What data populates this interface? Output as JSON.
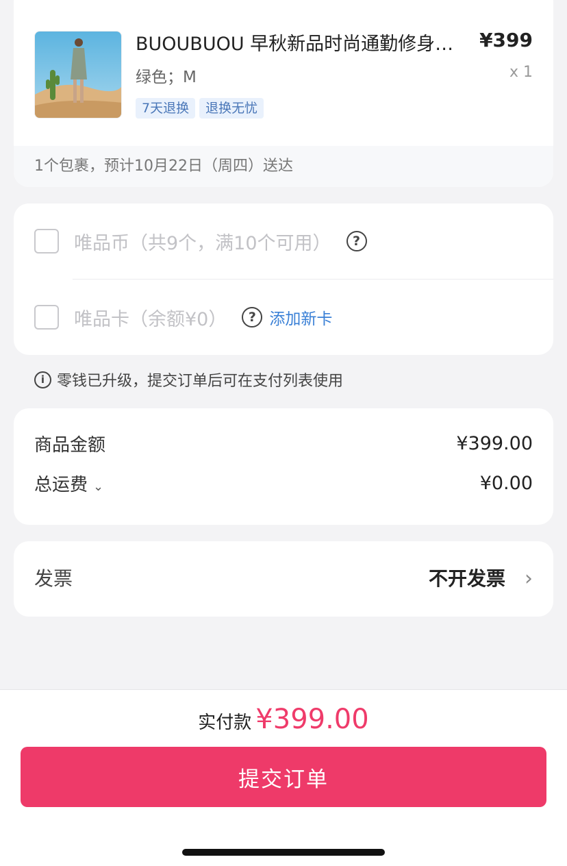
{
  "product": {
    "title": "BUOUBUOU 早秋新品时尚通勤修身…",
    "price": "¥399",
    "spec": "绿色；M",
    "quantity": "x 1",
    "tags": [
      "7天退换",
      "退换无忧"
    ],
    "delivery": "1个包裹，预计10月22日（周四）送达"
  },
  "discounts": {
    "coins_label": "唯品币（共9个，满10个可用）",
    "card_label": "唯品卡（余额¥0）",
    "add_card": "添加新卡"
  },
  "notice": "零钱已升级，提交订单后可在支付列表使用",
  "amounts": {
    "goods_label": "商品金额",
    "goods_value": "¥399.00",
    "shipping_label": "总运费",
    "shipping_value": "¥0.00"
  },
  "invoice": {
    "label": "发票",
    "value": "不开发票"
  },
  "checkout": {
    "total_label": "实付款",
    "total_value": "¥399.00",
    "submit_label": "提交订单"
  },
  "colors": {
    "accent": "#ee3a69",
    "link": "#3a80d6",
    "tag_bg": "#e9f1fc"
  }
}
